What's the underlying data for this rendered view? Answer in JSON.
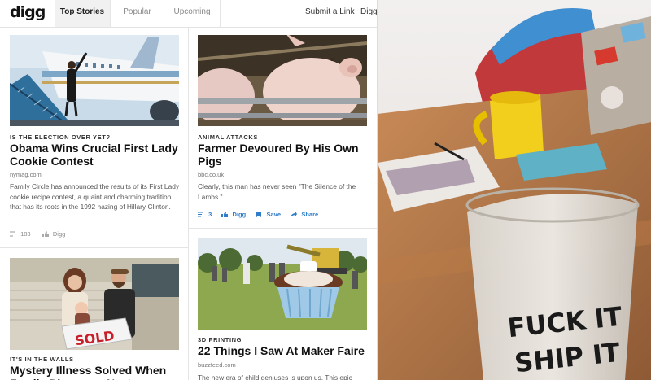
{
  "header": {
    "logo": "digg",
    "logo_version": "v1",
    "tabs": [
      {
        "label": "Top Stories",
        "active": true
      },
      {
        "label": "Popular",
        "active": false
      },
      {
        "label": "Upcoming",
        "active": false
      }
    ],
    "submit_link": "Submit a Link",
    "cut_link": "Digg"
  },
  "stories": [
    {
      "kicker": "IS THE ELECTION OVER YET?",
      "title": "Obama Wins Crucial First Lady Cookie Contest",
      "source": "nymag.com",
      "description": "Family Circle has announced the results of its First Lady cookie recipe contest, a quaint and charming tradition that has its roots in the 1992 hazing of Hillary Clinton.",
      "diggs": "183",
      "digg_label": "Digg"
    },
    {
      "kicker": "ANIMAL ATTACKS",
      "title": "Farmer Devoured By His Own Pigs",
      "source": "bbc.co.uk",
      "description": "Clearly, this man has never seen \"The Silence of the Lambs.\"",
      "diggs": "3",
      "digg_label": "Digg",
      "save_label": "Save",
      "share_label": "Share"
    },
    {
      "kicker": "IT'S IN THE WALLS",
      "title": "Mystery Illness Solved When Family Discovers Nest...",
      "image_text": "SOLD"
    },
    {
      "kicker": "3D PRINTING",
      "title": "22 Things I Saw At Maker Faire",
      "source": "buzzfeed.com",
      "description": "The new era of child geniuses is upon us. This epic"
    }
  ],
  "photo": {
    "glass_text_line1": "FUCK IT",
    "glass_text_line2": "SHIP IT"
  },
  "colors": {
    "accent_blue": "#2f7dc9",
    "text_dark": "#111111",
    "tab_active_bg": "#f1f1f1"
  }
}
